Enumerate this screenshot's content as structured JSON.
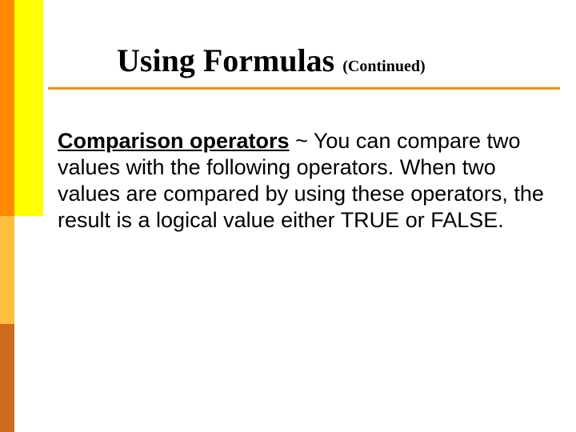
{
  "title": {
    "main": "Using Formulas",
    "continued": "(Continued)"
  },
  "content": {
    "term": "Comparison operators",
    "separator": " ~ ",
    "body": "You can compare two values with the following operators. When two values are compared by using these operators, the result is a logical value either TRUE or FALSE."
  }
}
